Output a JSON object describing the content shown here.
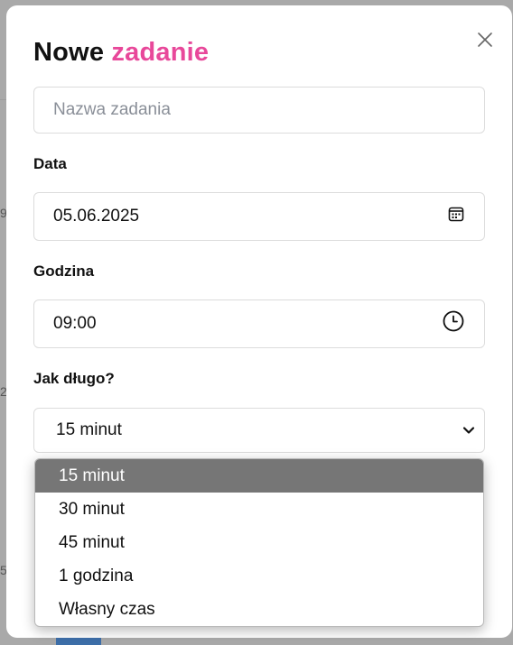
{
  "background": {
    "fragments": [
      "9",
      "2",
      "5"
    ]
  },
  "modal": {
    "title_main": "Nowe",
    "title_accent": "zadanie",
    "task_name": {
      "value": "",
      "placeholder": "Nazwa zadania"
    },
    "date": {
      "label": "Data",
      "value": "05.06.2025",
      "icon": "calendar-icon"
    },
    "time": {
      "label": "Godzina",
      "value": "09:00",
      "icon": "clock-icon"
    },
    "duration": {
      "label": "Jak długo?",
      "selected": "15 minut",
      "options": [
        "15 minut",
        "30 minut",
        "45 minut",
        "1 godzina",
        "Własny czas"
      ]
    }
  },
  "colors": {
    "accent": "#e8489a",
    "selected_option_bg": "#767676",
    "backdrop": "#a9a9a9"
  }
}
